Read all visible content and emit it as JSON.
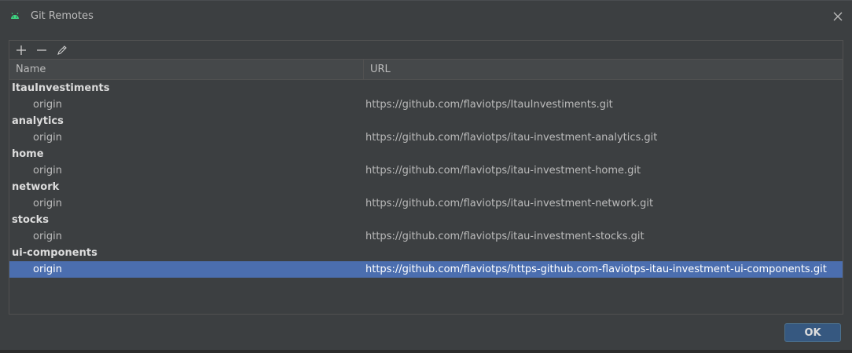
{
  "window": {
    "title": "Git Remotes",
    "icon": "android-icon",
    "close_icon": "close-icon"
  },
  "toolbar": {
    "add_icon": "plus-icon",
    "remove_icon": "minus-icon",
    "edit_icon": "pencil-icon"
  },
  "table": {
    "columns": {
      "name": "Name",
      "url": "URL"
    },
    "groups": [
      {
        "name": "ItauInvestiments",
        "remote": "origin",
        "url": "https://github.com/flaviotps/ItauInvestiments.git"
      },
      {
        "name": "analytics",
        "remote": "origin",
        "url": "https://github.com/flaviotps/itau-investment-analytics.git"
      },
      {
        "name": "home",
        "remote": "origin",
        "url": "https://github.com/flaviotps/itau-investment-home.git"
      },
      {
        "name": "network",
        "remote": "origin",
        "url": "https://github.com/flaviotps/itau-investment-network.git"
      },
      {
        "name": "stocks",
        "remote": "origin",
        "url": "https://github.com/flaviotps/itau-investment-stocks.git"
      },
      {
        "name": "ui-components",
        "remote": "origin",
        "url": "https://github.com/flaviotps/https-github.com-flaviotps-itau-investment-ui-components.git"
      }
    ],
    "selected_group_index": 5
  },
  "footer": {
    "ok_label": "OK"
  },
  "colors": {
    "selection": "#4b6eaf",
    "background": "#3c3f41",
    "ok_button": "#365880",
    "android_green": "#3ddc84"
  }
}
